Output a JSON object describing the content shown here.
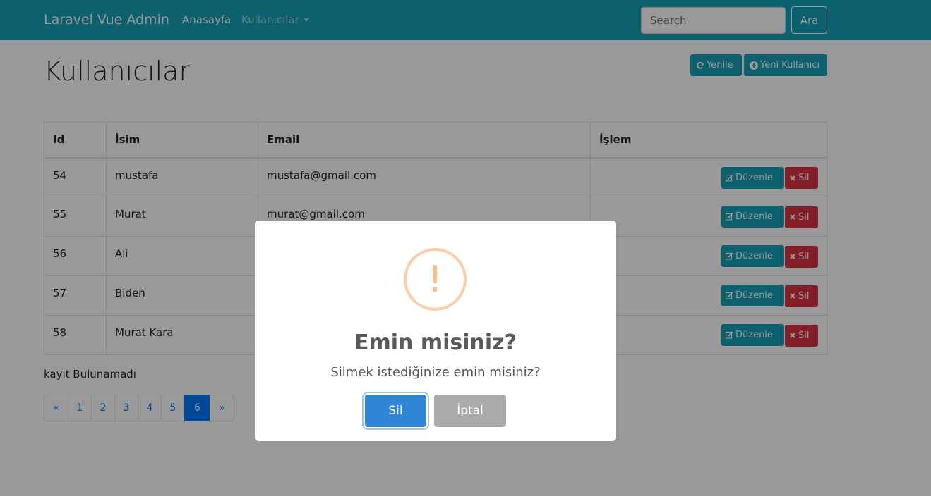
{
  "navbar": {
    "brand": "Laravel Vue Admin",
    "home": "Anasayfa",
    "users": "Kullanıcılar",
    "search_placeholder": "Search",
    "search_button": "Ara"
  },
  "page": {
    "title": "Kullanıcılar",
    "refresh_label": "Yenile",
    "new_user_label": "Yeni Kullanıcı"
  },
  "table": {
    "headers": [
      "Id",
      "İsim",
      "Email",
      "İşlem"
    ],
    "rows": [
      {
        "id": "54",
        "name": "mustafa",
        "email": "mustafa@gmail.com"
      },
      {
        "id": "55",
        "name": "Murat",
        "email": "murat@gmail.com"
      },
      {
        "id": "56",
        "name": "Ali",
        "email": ""
      },
      {
        "id": "57",
        "name": "Biden",
        "email": ""
      },
      {
        "id": "58",
        "name": "Murat Kara",
        "email": ""
      }
    ],
    "edit_label": "Düzenle",
    "delete_label": "Sil"
  },
  "status_text": "kayıt Bulunamadı",
  "pagination": {
    "prev": "«",
    "pages": [
      "1",
      "2",
      "3",
      "4",
      "5",
      "6"
    ],
    "active_page": "6",
    "next": "»"
  },
  "modal": {
    "icon": "!",
    "title": "Emin misiniz?",
    "text": "Silmek istediğinize emin misiniz?",
    "confirm_label": "Sil",
    "cancel_label": "İptal"
  },
  "colors": {
    "navbar": "#17a2b8",
    "danger": "#dc3545",
    "primary": "#007bff",
    "confirm": "#3085d6",
    "cancel": "#aaaaaa",
    "warning_icon": "#f8bb86"
  }
}
